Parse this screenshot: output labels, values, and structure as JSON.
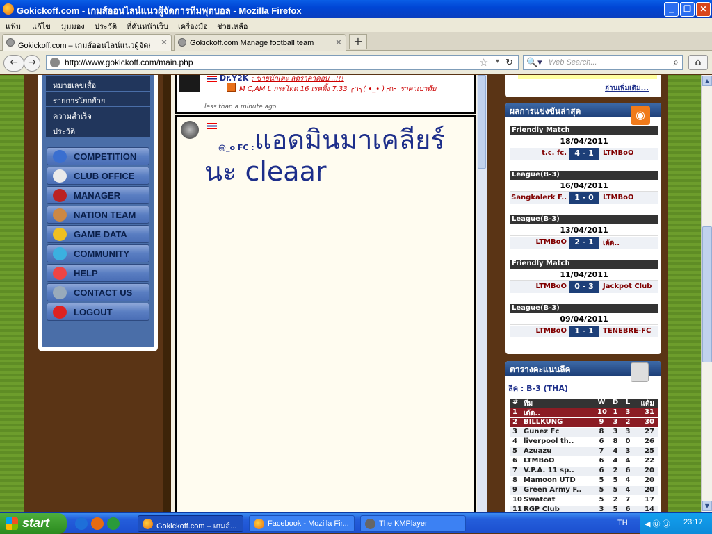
{
  "window": {
    "title": "Gokickoff.com - เกมส์ออนไลน์แนวผู้จัดการทีมฟุตบอล - Mozilla Firefox",
    "min": "_",
    "max": "❐",
    "close": "✕"
  },
  "menu": [
    "แฟ้ม",
    "แก้ไข",
    "มุมมอง",
    "ประวัติ",
    "ที่คั่นหน้าเว็บ",
    "เครื่องมือ",
    "ช่วยเหลือ"
  ],
  "tabs": [
    {
      "label": "Gokickoff.com – เกมส์ออนไลน์แนวผู้จัดกา..."
    },
    {
      "label": "Gokickoff.com Manage football team"
    }
  ],
  "nav": {
    "url": "http://www.gokickoff.com/main.php",
    "search_placeholder": "Web Search...",
    "back": "←",
    "forward": "→",
    "home": "⌂",
    "star": "☆",
    "reload": "↻",
    "newtab": "+",
    "tabclose": "✕",
    "dropdown": "▾",
    "search_glyph": "🔍▾",
    "magnifier": "⌕"
  },
  "sidebar": {
    "sublinks": [
      "หมายเลขเสื้อ",
      "รายการโยกย้าย",
      "ความสำเร็จ",
      "ประวัติ"
    ],
    "menu": [
      {
        "label": "COMPETITION",
        "color": "#3a6fd0"
      },
      {
        "label": "CLUB OFFICE",
        "color": "#eaeaea"
      },
      {
        "label": "MANAGER",
        "color": "#b22"
      },
      {
        "label": "NATION TEAM",
        "color": "#c84"
      },
      {
        "label": "GAME DATA",
        "color": "#f0c020"
      },
      {
        "label": "COMMUNITY",
        "color": "#3bb0e0"
      },
      {
        "label": "HELP",
        "color": "#e44"
      },
      {
        "label": "CONTACT US",
        "color": "#9ab"
      },
      {
        "label": "LOGOUT",
        "color": "#d22"
      }
    ]
  },
  "chat": {
    "top": {
      "name": "Dr.Y2K",
      "reply": ": ขายนักเตะ ลดราคาคอบ...!!!",
      "post": "M C,AM L กระโดด 16 เรตติ้ง 7.33 ╭∩╮( •_• )╭∩╮ ราคาเบาตับ",
      "time": "less than a minute ago"
    },
    "main": {
      "name": "@_o FC :",
      "text": "แอดมินมาเคลียร์นะ cleaar"
    }
  },
  "results": {
    "title": "ผลการแข่งขันล่าสุด",
    "rss": "◉",
    "matches": [
      {
        "comp": "Friendly Match",
        "date": "18/04/2011",
        "home": "t.c. fc.",
        "score": "4 - 1",
        "away": "LTMBoO"
      },
      {
        "comp": "League(B-3)",
        "date": "16/04/2011",
        "home": "Sangkalerk F..",
        "score": "1 - 0",
        "away": "LTMBoO"
      },
      {
        "comp": "League(B-3)",
        "date": "13/04/2011",
        "home": "LTMBoO",
        "score": "2 - 1",
        "away": "เด้ด.."
      },
      {
        "comp": "Friendly Match",
        "date": "11/04/2011",
        "home": "LTMBoO",
        "score": "0 - 3",
        "away": "Jackpot Club"
      },
      {
        "comp": "League(B-3)",
        "date": "09/04/2011",
        "home": "LTMBoO",
        "score": "1 - 1",
        "away": "TENEBRE-FC"
      }
    ]
  },
  "top_more": "อ่านเพิ่มเติม...",
  "standings": {
    "title": "ตารางคะแนนลีค",
    "league": "ลีค : B-3 (THA)",
    "header": {
      "pos": "#",
      "team": "ทีม",
      "w": "W",
      "d": "D",
      "l": "L",
      "pts": "แต้ม"
    },
    "rows": [
      {
        "pos": "1",
        "team": "เด้ด..",
        "w": "10",
        "d": "1",
        "l": "3",
        "pts": "31"
      },
      {
        "pos": "2",
        "team": "BILLKUNG",
        "w": "9",
        "d": "3",
        "l": "2",
        "pts": "30"
      },
      {
        "pos": "3",
        "team": "Gunez Fc",
        "w": "8",
        "d": "3",
        "l": "3",
        "pts": "27"
      },
      {
        "pos": "4",
        "team": "liverpool th..",
        "w": "6",
        "d": "8",
        "l": "0",
        "pts": "26"
      },
      {
        "pos": "5",
        "team": "Azuazu",
        "w": "7",
        "d": "4",
        "l": "3",
        "pts": "25"
      },
      {
        "pos": "6",
        "team": "LTMBoO",
        "w": "6",
        "d": "4",
        "l": "4",
        "pts": "22"
      },
      {
        "pos": "7",
        "team": "V.P.A. 11 sp..",
        "w": "6",
        "d": "2",
        "l": "6",
        "pts": "20"
      },
      {
        "pos": "8",
        "team": "Mamoon UTD",
        "w": "5",
        "d": "5",
        "l": "4",
        "pts": "20"
      },
      {
        "pos": "9",
        "team": "Green Army F..",
        "w": "5",
        "d": "5",
        "l": "4",
        "pts": "20"
      },
      {
        "pos": "10",
        "team": "Swatcat",
        "w": "5",
        "d": "2",
        "l": "7",
        "pts": "17"
      },
      {
        "pos": "11",
        "team": "RGP Club",
        "w": "3",
        "d": "5",
        "l": "6",
        "pts": "14"
      }
    ]
  },
  "scroll": {
    "up": "▲",
    "down": "▼"
  },
  "taskbar": {
    "start": "start",
    "lang": "TH",
    "time": "23:17",
    "tray_icons": "◀ Ⓤ Ⓤ",
    "tasks": [
      {
        "label": "Gokickoff.com – เกมส์...",
        "icon": "#e76b10"
      },
      {
        "label": "Facebook - Mozilla Fir...",
        "icon": "#e76b10"
      },
      {
        "label": "The KMPlayer",
        "icon": "#666"
      }
    ],
    "quicklaunch": [
      {
        "color": "#1e6fd9"
      },
      {
        "color": "#e76b10"
      },
      {
        "color": "#2a9a3a"
      }
    ]
  }
}
